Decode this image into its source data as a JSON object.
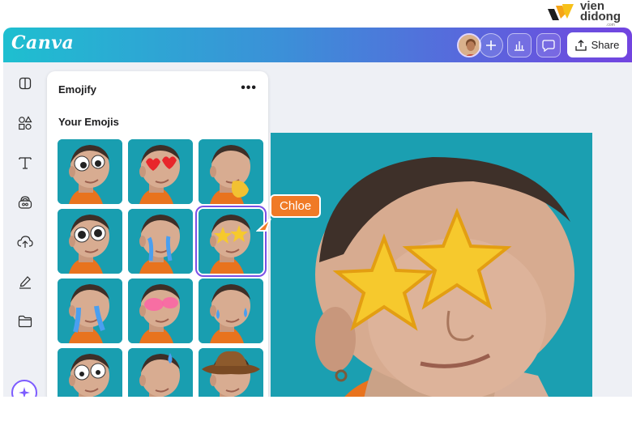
{
  "watermark": {
    "brand_line1": "vien",
    "brand_line2": "didong",
    "brand_line3": ".com"
  },
  "app": {
    "logo": "Canva",
    "share_label": "Share"
  },
  "panel": {
    "title": "Emojify",
    "more_label": "•••",
    "section_title": "Your Emojis",
    "emojis": [
      {
        "name": "googly-eyes"
      },
      {
        "name": "heart-eyes"
      },
      {
        "name": "drool"
      },
      {
        "name": "big-eyes"
      },
      {
        "name": "crying"
      },
      {
        "name": "star-eyes"
      },
      {
        "name": "tears"
      },
      {
        "name": "glow-eyes"
      },
      {
        "name": "sweat-tears"
      },
      {
        "name": "wide-eyes"
      },
      {
        "name": "sweat-drop"
      },
      {
        "name": "cowboy-hat"
      }
    ],
    "selected_index": 5
  },
  "collaborator": {
    "name": "Chloe",
    "color": "#f07a26"
  },
  "colors": {
    "accent": "#7a4fe6",
    "teal_bg": "#1b9fb1"
  }
}
